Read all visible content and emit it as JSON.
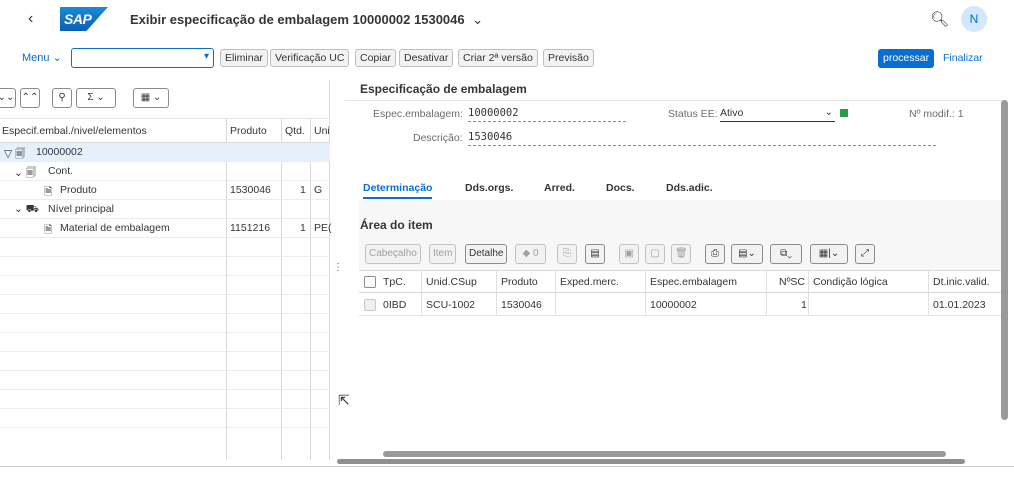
{
  "shell": {
    "logo": "SAP",
    "title": "Exibir especificação de embalagem 10000002 1530046",
    "title_chevron": "⌄",
    "avatar": "N"
  },
  "toolbar": {
    "menu": "Menu ⌄",
    "command_field_value": "",
    "buttons": [
      "Eliminar",
      "Verificação UC",
      "Copiar",
      "Desativar",
      "Criar 2ª versão",
      "Previsão"
    ],
    "primary": "processar",
    "finalize": "Finalizar"
  },
  "tree": {
    "headers": [
      "Especif.embal./nivel/elementos",
      "Produto",
      "Qtd.",
      "Uni"
    ],
    "rows": [
      {
        "label": "10000002",
        "icon": "▽ 🗐",
        "produto": "",
        "qtd": "",
        "uni": ""
      },
      {
        "label": "Cont.",
        "icon": "⌄ 🗐",
        "produto": "",
        "qtd": "",
        "uni": ""
      },
      {
        "label": "Produto",
        "icon": "🗎",
        "produto": "1530046",
        "qtd": "1",
        "uni": "G"
      },
      {
        "label": "Nível principal",
        "icon": "⌄ ⛟",
        "produto": "",
        "qtd": "",
        "uni": ""
      },
      {
        "label": "Material de embalagem",
        "icon": "🗎",
        "produto": "1151216",
        "qtd": "1",
        "uni": "PE("
      }
    ]
  },
  "spec": {
    "section_title": "Especificação de embalagem",
    "spec_label": "Espec.embalagem:",
    "spec_value": "10000002",
    "status_label": "Status EE:",
    "status_value": "Ativo",
    "status_color": "#2b9b48",
    "modif_label": "Nº modif.: 1",
    "desc_label": "Descrição:",
    "desc_value": "1530046"
  },
  "tabs": [
    "Determinação",
    "Dds.orgs.",
    "Arred.",
    "Docs.",
    "Dds.adic."
  ],
  "item_area": {
    "title": "Área do item",
    "buttons": [
      "Cabeçalho",
      "Item",
      "Detalhe",
      "◆ 0"
    ],
    "columns": [
      "TpC.",
      "Unid.CSup",
      "Produto",
      "Exped.merc.",
      "Espec.embalagem",
      "NºSC",
      "Condição lógica",
      "Dt.inic.valid."
    ],
    "rows": [
      {
        "tpc": "0IBD",
        "unid": "SCU-1002",
        "produto": "1530046",
        "exped": "",
        "espec": "10000002",
        "nsc": "1",
        "cond": "",
        "dt": "01.01.2023"
      }
    ]
  }
}
